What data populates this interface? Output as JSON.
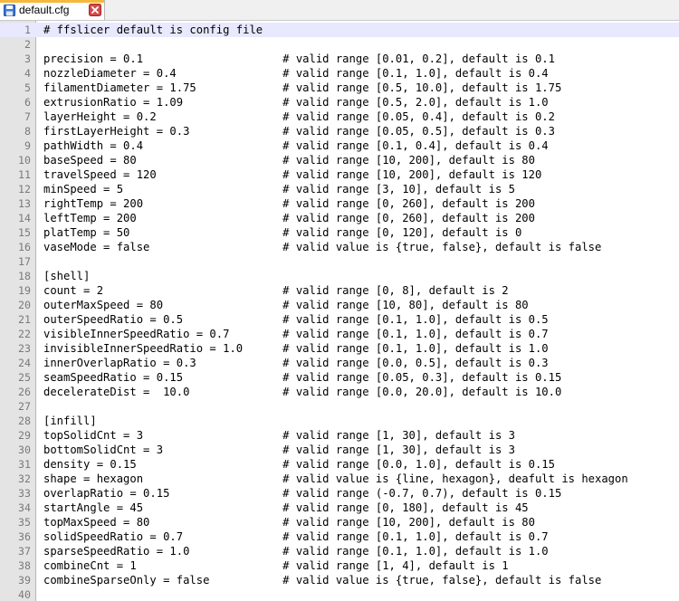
{
  "tab": {
    "title": "default.cfg",
    "icon": "save-icon",
    "close_icon": "close-icon",
    "accent_color": "#f6b73c"
  },
  "editor": {
    "current_line": 1,
    "lines": [
      {
        "n": "1",
        "text": "# ffslicer default is config file"
      },
      {
        "n": "2",
        "text": ""
      },
      {
        "n": "3",
        "text": "precision = 0.1                     # valid range [0.01, 0.2], default is 0.1"
      },
      {
        "n": "4",
        "text": "nozzleDiameter = 0.4                # valid range [0.1, 1.0], default is 0.4"
      },
      {
        "n": "5",
        "text": "filamentDiameter = 1.75             # valid range [0.5, 10.0], default is 1.75"
      },
      {
        "n": "6",
        "text": "extrusionRatio = 1.09               # valid range [0.5, 2.0], default is 1.0"
      },
      {
        "n": "7",
        "text": "layerHeight = 0.2                   # valid range [0.05, 0.4], default is 0.2"
      },
      {
        "n": "8",
        "text": "firstLayerHeight = 0.3              # valid range [0.05, 0.5], default is 0.3"
      },
      {
        "n": "9",
        "text": "pathWidth = 0.4                     # valid range [0.1, 0.4], default is 0.4"
      },
      {
        "n": "10",
        "text": "baseSpeed = 80                      # valid range [10, 200], default is 80"
      },
      {
        "n": "11",
        "text": "travelSpeed = 120                   # valid range [10, 200], default is 120"
      },
      {
        "n": "12",
        "text": "minSpeed = 5                        # valid range [3, 10], default is 5"
      },
      {
        "n": "13",
        "text": "rightTemp = 200                     # valid range [0, 260], default is 200"
      },
      {
        "n": "14",
        "text": "leftTemp = 200                      # valid range [0, 260], default is 200"
      },
      {
        "n": "15",
        "text": "platTemp = 50                       # valid range [0, 120], default is 0"
      },
      {
        "n": "16",
        "text": "vaseMode = false                    # valid value is {true, false}, default is false"
      },
      {
        "n": "17",
        "text": ""
      },
      {
        "n": "18",
        "text": "[shell]"
      },
      {
        "n": "19",
        "text": "count = 2                           # valid range [0, 8], default is 2"
      },
      {
        "n": "20",
        "text": "outerMaxSpeed = 80                  # valid range [10, 80], default is 80"
      },
      {
        "n": "21",
        "text": "outerSpeedRatio = 0.5               # valid range [0.1, 1.0], default is 0.5"
      },
      {
        "n": "22",
        "text": "visibleInnerSpeedRatio = 0.7        # valid range [0.1, 1.0], default is 0.7"
      },
      {
        "n": "23",
        "text": "invisibleInnerSpeedRatio = 1.0      # valid range [0.1, 1.0], default is 1.0"
      },
      {
        "n": "24",
        "text": "innerOverlapRatio = 0.3             # valid range [0.0, 0.5], default is 0.3"
      },
      {
        "n": "25",
        "text": "seamSpeedRatio = 0.15               # valid range [0.05, 0.3], default is 0.15"
      },
      {
        "n": "26",
        "text": "decelerateDist =  10.0              # valid range [0.0, 20.0], default is 10.0"
      },
      {
        "n": "27",
        "text": ""
      },
      {
        "n": "28",
        "text": "[infill]"
      },
      {
        "n": "29",
        "text": "topSolidCnt = 3                     # valid range [1, 30], default is 3"
      },
      {
        "n": "30",
        "text": "bottomSolidCnt = 3                  # valid range [1, 30], default is 3"
      },
      {
        "n": "31",
        "text": "density = 0.15                      # valid range [0.0, 1.0], default is 0.15"
      },
      {
        "n": "32",
        "text": "shape = hexagon                     # valid value is {line, hexagon}, deafult is hexagon"
      },
      {
        "n": "33",
        "text": "overlapRatio = 0.15                 # valid range (-0.7, 0.7), default is 0.15"
      },
      {
        "n": "34",
        "text": "startAngle = 45                     # valid range [0, 180], default is 45"
      },
      {
        "n": "35",
        "text": "topMaxSpeed = 80                    # valid range [10, 200], default is 80"
      },
      {
        "n": "36",
        "text": "solidSpeedRatio = 0.7               # valid range [0.1, 1.0], default is 0.7"
      },
      {
        "n": "37",
        "text": "sparseSpeedRatio = 1.0              # valid range [0.1, 1.0], default is 1.0"
      },
      {
        "n": "38",
        "text": "combineCnt = 1                      # valid range [1, 4], default is 1"
      },
      {
        "n": "39",
        "text": "combineSparseOnly = false           # valid value is {true, false}, default is false"
      },
      {
        "n": "40",
        "text": ""
      }
    ]
  }
}
